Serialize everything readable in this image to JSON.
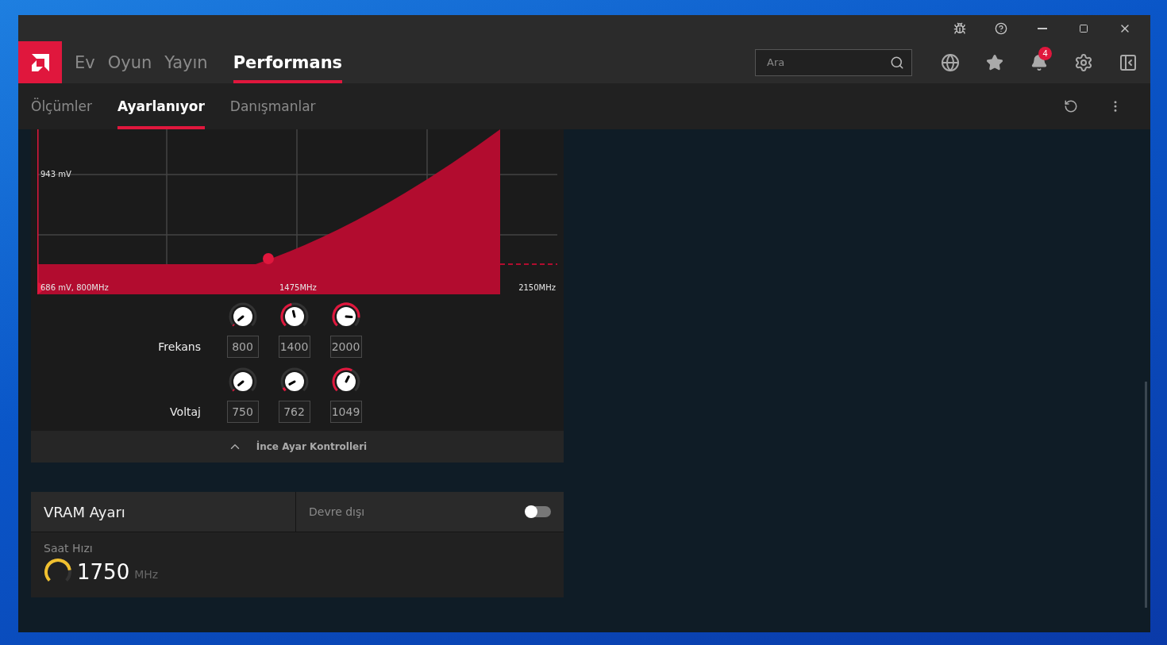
{
  "search": {
    "placeholder": "Ara"
  },
  "main_tabs": [
    {
      "label": "Ev",
      "selected": false
    },
    {
      "label": "Oyun",
      "selected": false
    },
    {
      "label": "Yayın",
      "selected": false
    },
    {
      "label": "Performans",
      "selected": true
    }
  ],
  "notifications": {
    "count": "4"
  },
  "sub_tabs": [
    {
      "label": "Ölçümler",
      "selected": false
    },
    {
      "label": "Ayarlanıyor",
      "selected": true
    },
    {
      "label": "Danışmanlar",
      "selected": false
    }
  ],
  "curve": {
    "label_top": "943 mV",
    "label_start": "686 mV, 800MHz",
    "label_mid": "1475MHz",
    "label_end": "2150MHz"
  },
  "tuning_rows": [
    {
      "label": "Frekans",
      "knobs": [
        {
          "value": "800",
          "level": 0.02
        },
        {
          "value": "1400",
          "level": 0.45
        },
        {
          "value": "2000",
          "level": 0.85
        }
      ]
    },
    {
      "label": "Voltaj",
      "knobs": [
        {
          "value": "750",
          "level": 0.02
        },
        {
          "value": "762",
          "level": 0.06
        },
        {
          "value": "1049",
          "level": 0.6
        }
      ]
    }
  ],
  "collapse": {
    "label": "İnce Ayar Kontrolleri",
    "expanded": true
  },
  "vram": {
    "title": "VRAM Ayarı",
    "status": "Devre dışı",
    "on": false,
    "metric_label": "Saat Hızı",
    "value": "1750",
    "unit": "MHz",
    "level": 0.8
  }
}
